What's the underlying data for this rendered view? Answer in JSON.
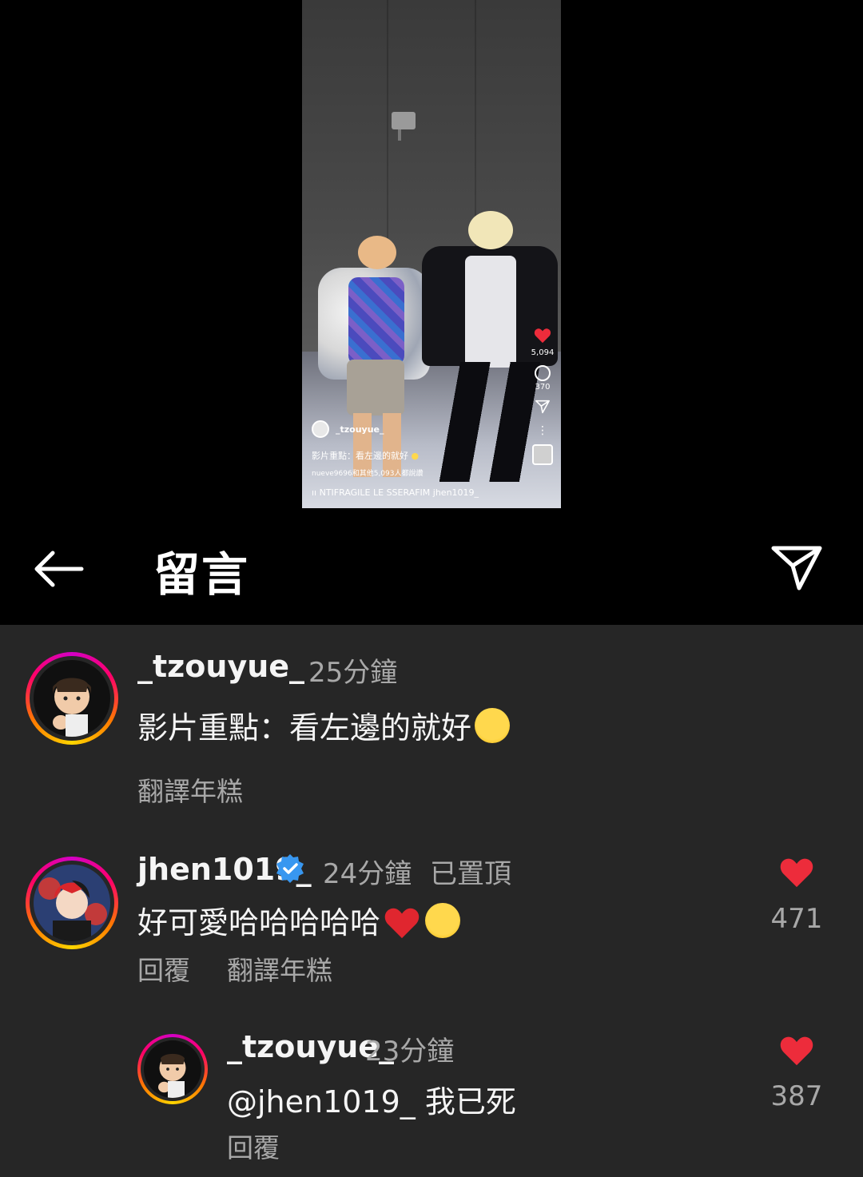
{
  "video": {
    "username": "_tzouyue_",
    "caption": "影片重點：看左邊的就好",
    "likes_line": "nueve9696和其他5,093人都說讚",
    "music_line": "ıı NTIFRAGILE   LE SSERAFIM   jhen1019_",
    "like_count": "5,094",
    "comment_count": "370"
  },
  "header": {
    "title": "留言"
  },
  "comments": [
    {
      "username": "_tzouyue_",
      "time": "25分鐘",
      "text": "影片重點：看左邊的就好",
      "emoji": "smiling-tear-emoji",
      "translate": "翻譯年糕"
    },
    {
      "username": "jhen1019_",
      "verified": true,
      "time": "24分鐘",
      "pinned": "已置頂",
      "text": "好可愛哈哈哈哈哈",
      "emojis": [
        "red-heart-emoji",
        "tears-of-joy-emoji"
      ],
      "reply": "回覆",
      "translate": "翻譯年糕",
      "likes": "471"
    },
    {
      "username": "_tzouyue_",
      "time": "23分鐘",
      "text": "@jhen1019_ 我已死",
      "reply": "回覆",
      "likes": "387"
    }
  ],
  "colors": {
    "heart": "#ed2c3b",
    "verified": "#3897f0",
    "secondary_text": "#a8a8a8",
    "background": "#262626"
  }
}
